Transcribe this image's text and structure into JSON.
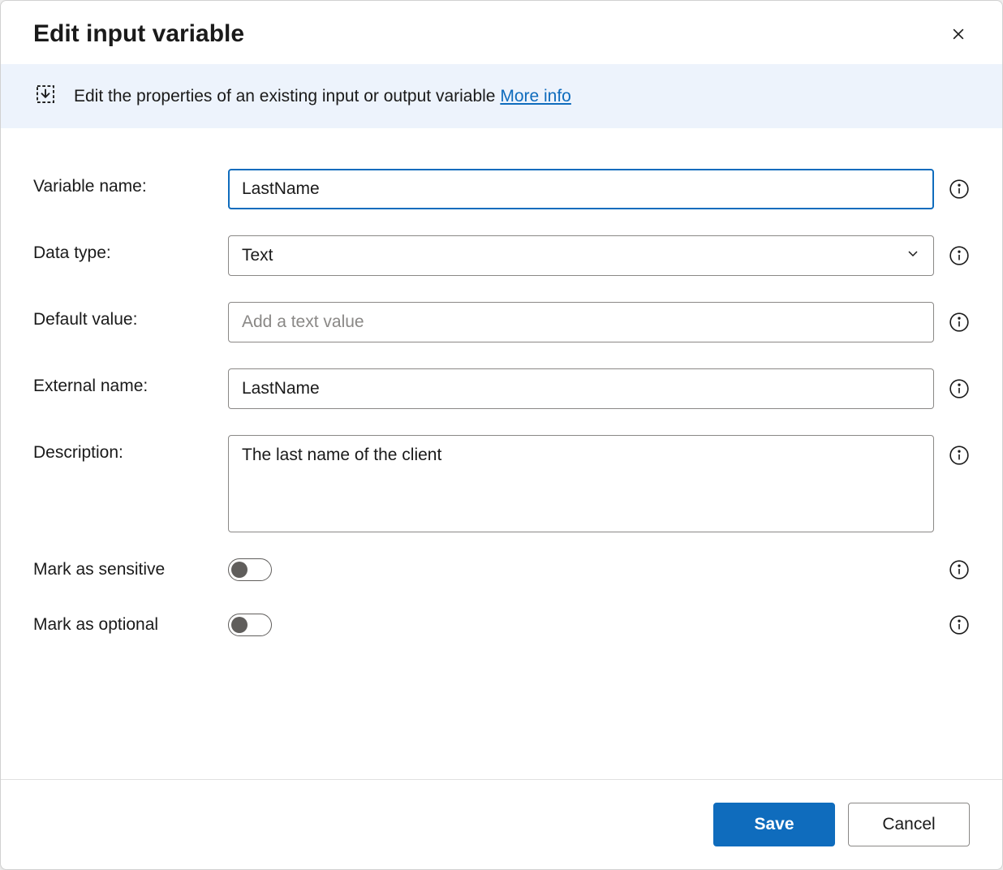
{
  "dialog": {
    "title": "Edit input variable"
  },
  "banner": {
    "text": "Edit the properties of an existing input or output variable ",
    "link": "More info"
  },
  "form": {
    "variable_name": {
      "label": "Variable name:",
      "value": "LastName"
    },
    "data_type": {
      "label": "Data type:",
      "value": "Text"
    },
    "default_value": {
      "label": "Default value:",
      "value": "",
      "placeholder": "Add a text value"
    },
    "external_name": {
      "label": "External name:",
      "value": "LastName"
    },
    "description": {
      "label": "Description:",
      "value": "The last name of the client"
    },
    "mark_sensitive": {
      "label": "Mark as sensitive",
      "checked": false
    },
    "mark_optional": {
      "label": "Mark as optional",
      "checked": false
    }
  },
  "footer": {
    "save": "Save",
    "cancel": "Cancel"
  }
}
